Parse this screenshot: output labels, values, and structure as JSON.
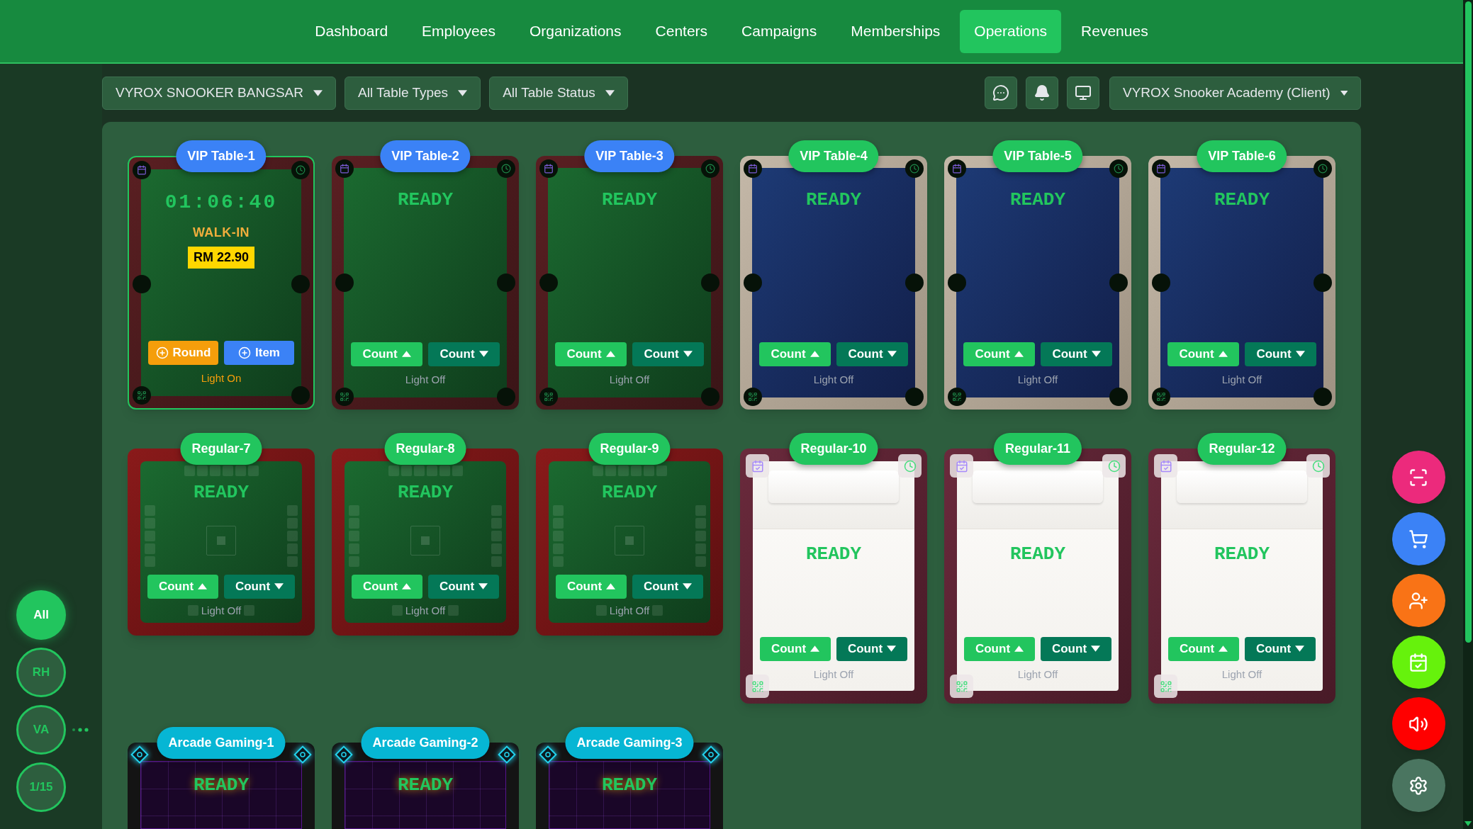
{
  "nav": {
    "items": [
      {
        "label": "Dashboard",
        "selected": false
      },
      {
        "label": "Employees",
        "selected": false
      },
      {
        "label": "Organizations",
        "selected": false
      },
      {
        "label": "Centers",
        "selected": false
      },
      {
        "label": "Campaigns",
        "selected": false
      },
      {
        "label": "Memberships",
        "selected": false
      },
      {
        "label": "Operations",
        "selected": true
      },
      {
        "label": "Revenues",
        "selected": false
      }
    ]
  },
  "filters": {
    "dropdowns": [
      "VYROX SNOOKER BANGSAR",
      "All Table Types",
      "All Table Status"
    ],
    "account": "VYROX Snooker Academy (Client)"
  },
  "side_filters": [
    {
      "label": "All",
      "selected": true,
      "more": false
    },
    {
      "label": "RH",
      "selected": false,
      "more": false
    },
    {
      "label": "VA",
      "selected": false,
      "more": true
    },
    {
      "label": "1/15",
      "selected": false,
      "more": false
    }
  ],
  "tables": [
    {
      "name": "VIP Table-1",
      "kind": "pool-red",
      "active": true,
      "timer": "01:06:40",
      "booking": "WALK-IN",
      "price": "RM 22.90",
      "buttons": [
        {
          "label": "Round",
          "kind": "add-round"
        },
        {
          "label": "Item",
          "kind": "add-item"
        }
      ],
      "light": "Light On",
      "light_on": true
    },
    {
      "name": "VIP Table-2",
      "kind": "pool-red",
      "active": false,
      "status": "READY",
      "buttons": [
        {
          "label": "Count",
          "kind": "count-up"
        },
        {
          "label": "Count",
          "kind": "count-down"
        }
      ],
      "light": "Light Off",
      "light_on": false
    },
    {
      "name": "VIP Table-3",
      "kind": "pool-red",
      "active": false,
      "status": "READY",
      "buttons": [
        {
          "label": "Count",
          "kind": "count-up"
        },
        {
          "label": "Count",
          "kind": "count-down"
        }
      ],
      "light": "Light Off",
      "light_on": false
    },
    {
      "name": "VIP Table-4",
      "kind": "pool-blue",
      "active": false,
      "status": "READY",
      "buttons": [
        {
          "label": "Count",
          "kind": "count-up"
        },
        {
          "label": "Count",
          "kind": "count-down"
        }
      ],
      "light": "Light Off",
      "light_on": false
    },
    {
      "name": "VIP Table-5",
      "kind": "pool-blue",
      "active": false,
      "status": "READY",
      "buttons": [
        {
          "label": "Count",
          "kind": "count-up"
        },
        {
          "label": "Count",
          "kind": "count-down"
        }
      ],
      "light": "Light Off",
      "light_on": false
    },
    {
      "name": "VIP Table-6",
      "kind": "pool-blue",
      "active": false,
      "status": "READY",
      "buttons": [
        {
          "label": "Count",
          "kind": "count-up"
        },
        {
          "label": "Count",
          "kind": "count-down"
        }
      ],
      "light": "Light Off",
      "light_on": false
    },
    {
      "name": "Regular-7",
      "kind": "square",
      "active": false,
      "status": "READY",
      "buttons": [
        {
          "label": "Count",
          "kind": "count-up"
        },
        {
          "label": "Count",
          "kind": "count-down"
        }
      ],
      "light": "Light Off",
      "light_on": false
    },
    {
      "name": "Regular-8",
      "kind": "square",
      "active": false,
      "status": "READY",
      "buttons": [
        {
          "label": "Count",
          "kind": "count-up"
        },
        {
          "label": "Count",
          "kind": "count-down"
        }
      ],
      "light": "Light Off",
      "light_on": false
    },
    {
      "name": "Regular-9",
      "kind": "square",
      "active": false,
      "status": "READY",
      "buttons": [
        {
          "label": "Count",
          "kind": "count-up"
        },
        {
          "label": "Count",
          "kind": "count-down"
        }
      ],
      "light": "Light Off",
      "light_on": false
    },
    {
      "name": "Regular-10",
      "kind": "white",
      "active": false,
      "status": "READY",
      "buttons": [
        {
          "label": "Count",
          "kind": "count-up"
        },
        {
          "label": "Count",
          "kind": "count-down"
        }
      ],
      "light": "Light Off",
      "light_on": false
    },
    {
      "name": "Regular-11",
      "kind": "white",
      "active": false,
      "status": "READY",
      "buttons": [
        {
          "label": "Count",
          "kind": "count-up"
        },
        {
          "label": "Count",
          "kind": "count-down"
        }
      ],
      "light": "Light Off",
      "light_on": false
    },
    {
      "name": "Regular-12",
      "kind": "white",
      "active": false,
      "status": "READY",
      "buttons": [
        {
          "label": "Count",
          "kind": "count-up"
        },
        {
          "label": "Count",
          "kind": "count-down"
        }
      ],
      "light": "Light Off",
      "light_on": false
    },
    {
      "name": "Arcade Gaming-1",
      "kind": "arcade",
      "active": false,
      "status": "READY"
    },
    {
      "name": "Arcade Gaming-2",
      "kind": "arcade",
      "active": false,
      "status": "READY"
    },
    {
      "name": "Arcade Gaming-3",
      "kind": "arcade",
      "active": false,
      "status": "READY"
    }
  ]
}
